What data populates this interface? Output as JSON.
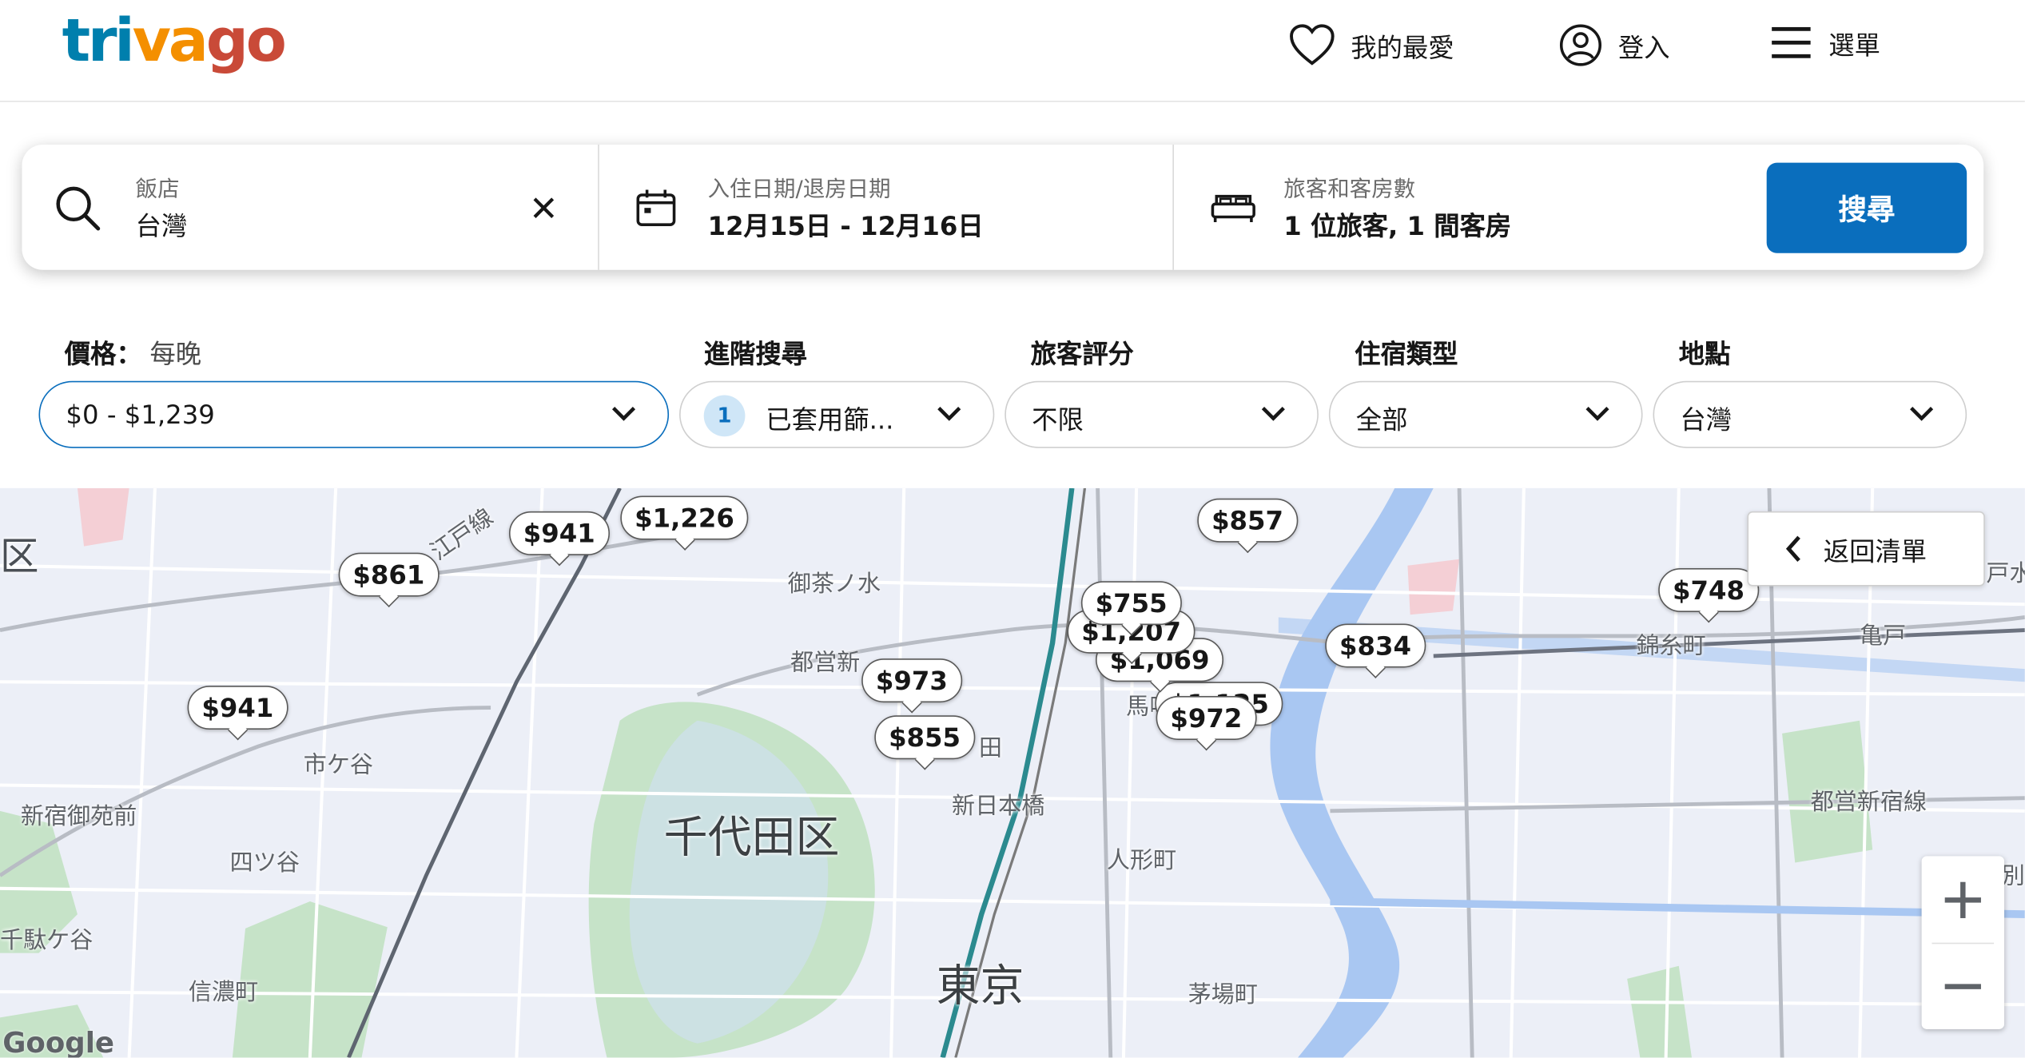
{
  "header": {
    "logo": {
      "part1": "tri",
      "part2": "va",
      "part3": "go"
    },
    "favorites_label": "我的最愛",
    "login_label": "登入",
    "menu_label": "選單"
  },
  "search": {
    "hotel_label": "飯店",
    "hotel_value": "台灣",
    "dates_label": "入住日期/退房日期",
    "dates_value": "12月15日 - 12月16日",
    "guests_label": "旅客和客房數",
    "guests_value": "1 位旅客, 1 間客房",
    "search_button": "搜尋"
  },
  "filters": {
    "price": {
      "label": "價格：",
      "sublabel": "每晚",
      "value": "$0 - $1,239"
    },
    "advanced": {
      "label": "進階搜尋",
      "badge": "1",
      "value": "已套用篩..."
    },
    "rating": {
      "label": "旅客評分",
      "value": "不限"
    },
    "type": {
      "label": "住宿類型",
      "value": "全部"
    },
    "location": {
      "label": "地點",
      "value": "台灣"
    }
  },
  "map": {
    "back_to_list": "返回清單",
    "zoom_in": "+",
    "zoom_out": "−",
    "attribution": "Google",
    "labels": {
      "chiyoda": "千代田区",
      "tokyo": "東京",
      "ochanomizu": "御茶ノ水",
      "ichigaya": "市ケ谷",
      "yotsuya": "四ツ谷",
      "shinanomachi": "信濃町",
      "sendagaya": "千駄ケ谷",
      "shinjuku_gyoen": "新宿御苑前",
      "shin_nihonbashi": "新日本橋",
      "ningyocho": "人形町",
      "kayabacho": "茅場町",
      "kinshicho": "錦糸町",
      "kameido": "亀戸",
      "toei_shinjuku": "都営新宿線",
      "toei_shin": "都営新",
      "edogawa": "江戸線",
      "bakuro": "馬喰",
      "ku_left": "区",
      "kanda": "田",
      "edge_right": "戸水",
      "edge_right2": "別"
    },
    "prices": [
      "$941",
      "$1,226",
      "$861",
      "$857",
      "$748",
      "$755",
      "$1,207",
      "$1,069",
      "$834",
      "$973",
      "$855",
      "$972",
      "$941",
      "$1,125"
    ]
  }
}
